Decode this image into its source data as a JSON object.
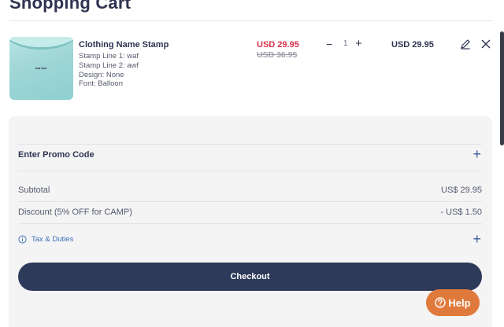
{
  "page": {
    "title": "Shopping Cart"
  },
  "item": {
    "image_alt": "mint t-shirt with stamp",
    "stamp_preview": "waf awf",
    "name": "Clothing Name Stamp",
    "details": [
      "Stamp Line 1:  waf",
      "Stamp Line 2:  awf",
      "Design:  None",
      "Font:  Balloon"
    ],
    "sale_price": "USD 29.95",
    "original_price": "USD 36.95",
    "quantity": "1",
    "line_total": "USD 29.95",
    "icons": {
      "edit": "pencil-icon",
      "remove": "close-icon",
      "minus": "minus-icon",
      "plus": "plus-icon"
    }
  },
  "summary": {
    "promo_label": "Enter Promo Code",
    "promo_toggle": "+",
    "subtotal_label": "Subtotal",
    "subtotal_value": "US$ 29.95",
    "discount_label": "Discount (5% OFF for CAMP)",
    "discount_value": "- US$ 1.50",
    "tax_label": "Tax & Duties",
    "tax_toggle": "+",
    "checkout_label": "Checkout"
  },
  "help": {
    "label": "Help"
  },
  "colors": {
    "primary_navy": "#2e3a5a",
    "sale_red": "#d9314a",
    "link_blue": "#3a6fb5",
    "help_orange": "#e07a3c",
    "summary_bg": "#f4f4f5"
  }
}
